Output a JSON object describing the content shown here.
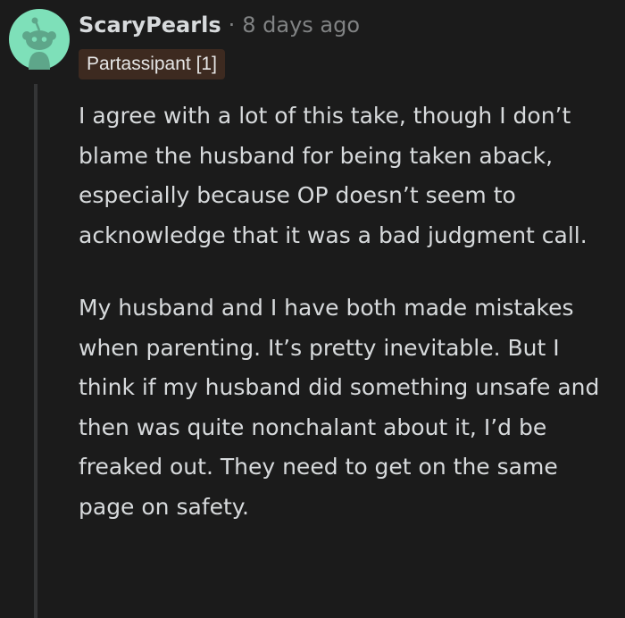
{
  "comment": {
    "username": "ScaryPearls",
    "separator": "·",
    "timestamp": "8 days ago",
    "flair": "Partassipant [1]",
    "paragraphs": [
      "I agree with a lot of this take, though I don’t blame the husband for being taken aback, especially because OP doesn’t seem to acknowledge that it was a bad judgment call.",
      "My husband and I have both made mistakes when parenting. It’s pretty inevitable. But I think if my husband did something unsafe and then was quite nonchalant about it, I’d be freaked out. They need to get on the same page on safety."
    ]
  },
  "colors": {
    "background": "#1b1b1b",
    "avatar_background": "#7ee0b9",
    "flair_background": "#3d2a20",
    "text": "#d7dadc",
    "muted": "#818384"
  },
  "icons": {
    "avatar": "reddit-snoo-avatar-icon"
  }
}
